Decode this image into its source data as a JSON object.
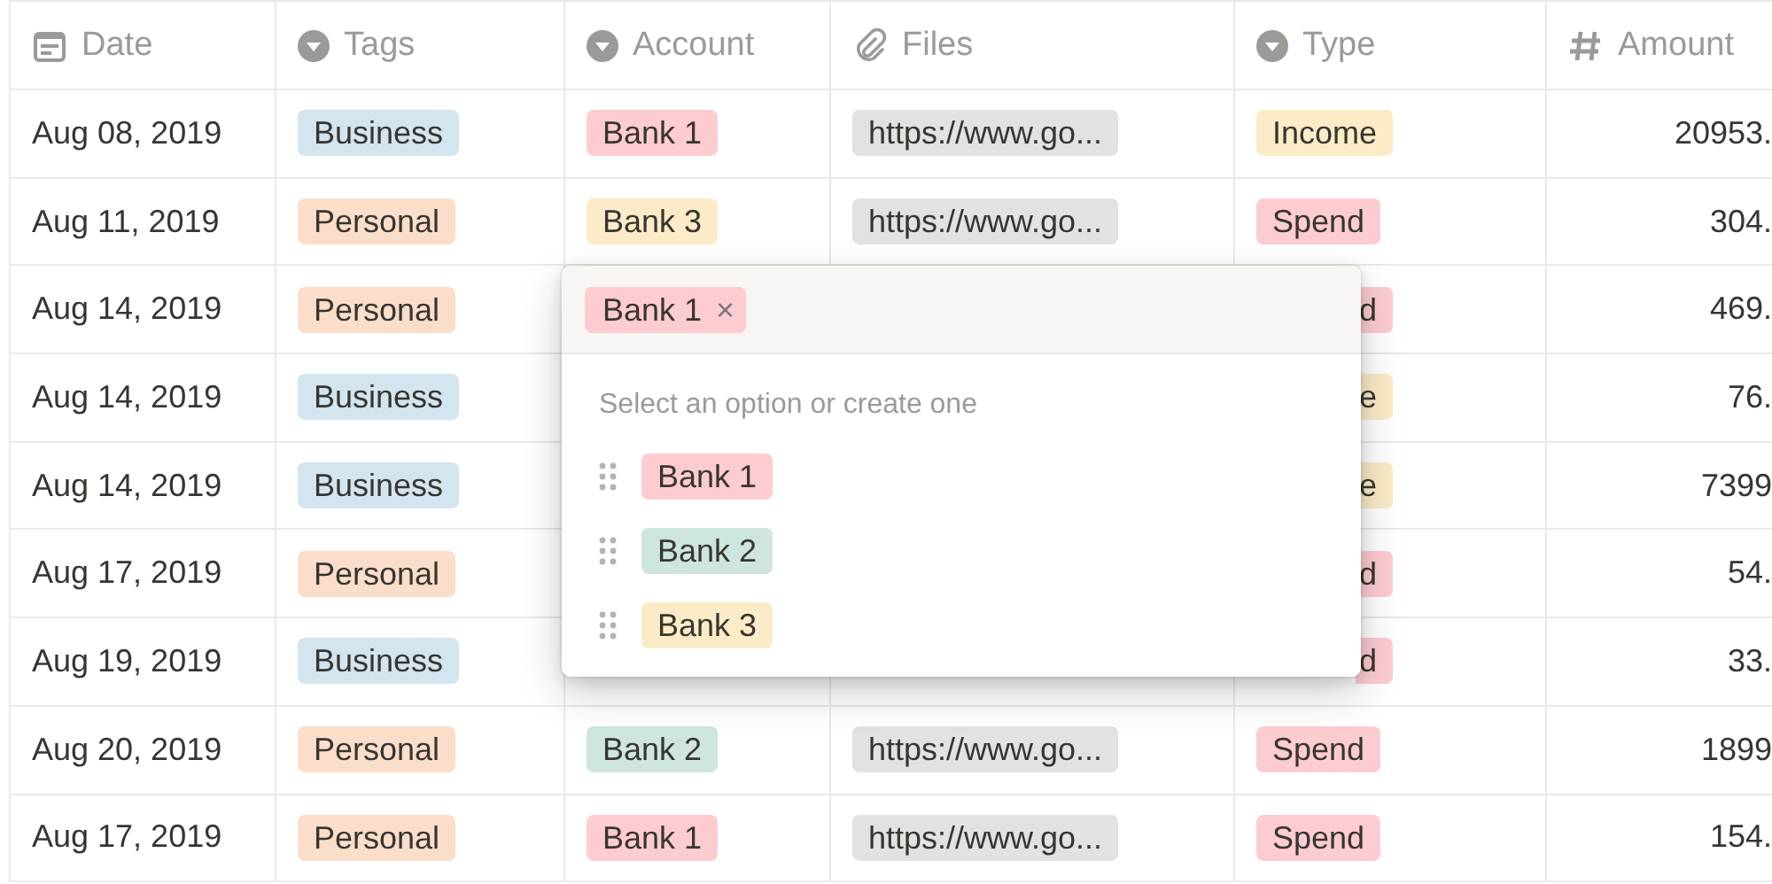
{
  "columns": [
    {
      "kind": "date",
      "label": "Date"
    },
    {
      "kind": "select",
      "label": "Tags"
    },
    {
      "kind": "select",
      "label": "Account"
    },
    {
      "kind": "file",
      "label": "Files"
    },
    {
      "kind": "select",
      "label": "Type"
    },
    {
      "kind": "number",
      "label": "Amount"
    }
  ],
  "rows": [
    {
      "covered": false,
      "date": "Aug 08, 2019",
      "tag": {
        "text": "Business",
        "color": "#d3e5ef"
      },
      "account": {
        "text": "Bank 1",
        "color": "#fdccd1"
      },
      "file": "https://www.go...",
      "type": {
        "text": "Income",
        "color": "#fbecc7"
      },
      "amount": "20953."
    },
    {
      "covered": false,
      "date": "Aug 11, 2019",
      "tag": {
        "text": "Personal",
        "color": "#fadec9"
      },
      "account": {
        "text": "Bank 3",
        "color": "#fbecc7"
      },
      "file": "https://www.go...",
      "type": {
        "text": "Spend",
        "color": "#fdccd1"
      },
      "amount": "304."
    },
    {
      "covered": true,
      "date": "Aug 14, 2019",
      "tag": {
        "text": "Personal",
        "color": "#fadec9"
      },
      "type": {
        "text": "d",
        "color": "#fdccd1"
      },
      "amount": "469."
    },
    {
      "covered": true,
      "date": "Aug 14, 2019",
      "tag": {
        "text": "Business",
        "color": "#d3e5ef"
      },
      "type": {
        "text": "e",
        "color": "#fbecc7"
      },
      "amount": "76."
    },
    {
      "covered": true,
      "date": "Aug 14, 2019",
      "tag": {
        "text": "Business",
        "color": "#d3e5ef"
      },
      "type": {
        "text": "e",
        "color": "#fbecc7"
      },
      "amount": "7399"
    },
    {
      "covered": true,
      "date": "Aug 17, 2019",
      "tag": {
        "text": "Personal",
        "color": "#fadec9"
      },
      "type": {
        "text": "d",
        "color": "#fdccd1"
      },
      "amount": "54."
    },
    {
      "covered": true,
      "date": "Aug 19, 2019",
      "tag": {
        "text": "Business",
        "color": "#d3e5ef"
      },
      "type": {
        "text": "d",
        "color": "#fdccd1"
      },
      "amount": "33."
    },
    {
      "covered": false,
      "date": "Aug 20, 2019",
      "tag": {
        "text": "Personal",
        "color": "#fadec9"
      },
      "account": {
        "text": "Bank 2",
        "color": "#cde6df"
      },
      "file": "https://www.go...",
      "type": {
        "text": "Spend",
        "color": "#fdccd1"
      },
      "amount": "1899"
    },
    {
      "covered": false,
      "date": "Aug 17, 2019",
      "tag": {
        "text": "Personal",
        "color": "#fadec9"
      },
      "account": {
        "text": "Bank 1",
        "color": "#fdccd1"
      },
      "file": "https://www.go...",
      "type": {
        "text": "Spend",
        "color": "#fdccd1"
      },
      "amount": "154."
    }
  ],
  "popup": {
    "selected": {
      "text": "Bank 1",
      "color": "#fdccd1",
      "remove": "×"
    },
    "hint": "Select an option or create one",
    "options": [
      {
        "text": "Bank 1",
        "color": "#fdccd1"
      },
      {
        "text": "Bank 2",
        "color": "#cde6df"
      },
      {
        "text": "Bank 3",
        "color": "#fbecc7"
      }
    ]
  }
}
